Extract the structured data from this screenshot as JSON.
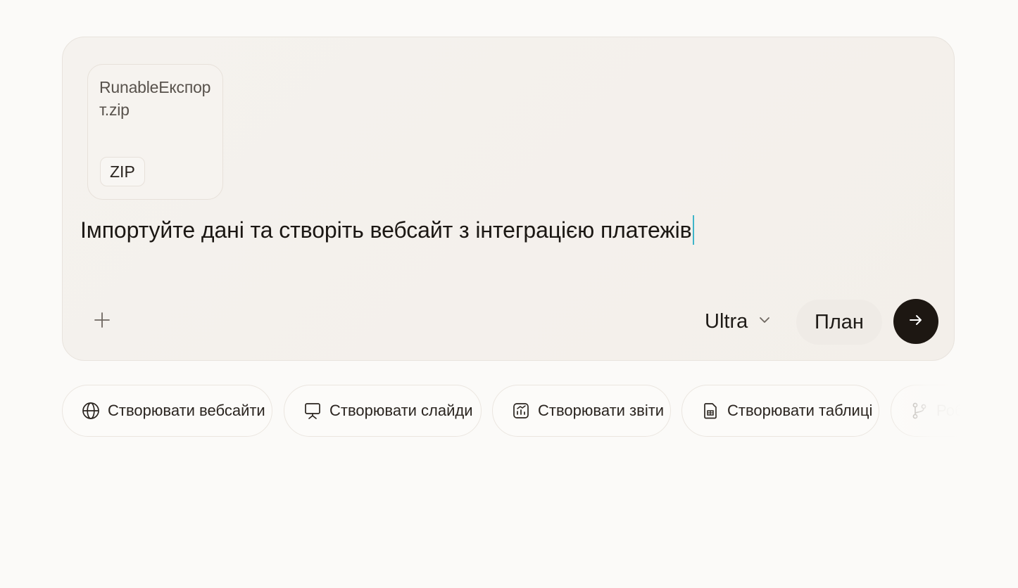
{
  "composer": {
    "attachment": {
      "filename": "RunableЕкспорт.zip",
      "type": "ZIP"
    },
    "prompt": "Імпортуйте дані та створіть вебсайт з інтеграцією платежів",
    "model": "Ultra",
    "plan_label": "План"
  },
  "suggestions": [
    {
      "label": "Створювати вебсайти",
      "icon": "globe-icon"
    },
    {
      "label": "Створювати слайди",
      "icon": "presentation-icon"
    },
    {
      "label": "Створювати звіти",
      "icon": "report-chart-icon"
    },
    {
      "label": "Створювати таблиці",
      "icon": "spreadsheet-icon"
    },
    {
      "label": "Роб",
      "icon": "workflow-branch-icon"
    }
  ],
  "colors": {
    "background": "#fbfaf8",
    "composer_bg": "#f4f1ed",
    "send_button": "#1d1712",
    "caret": "#3fb5c9"
  }
}
